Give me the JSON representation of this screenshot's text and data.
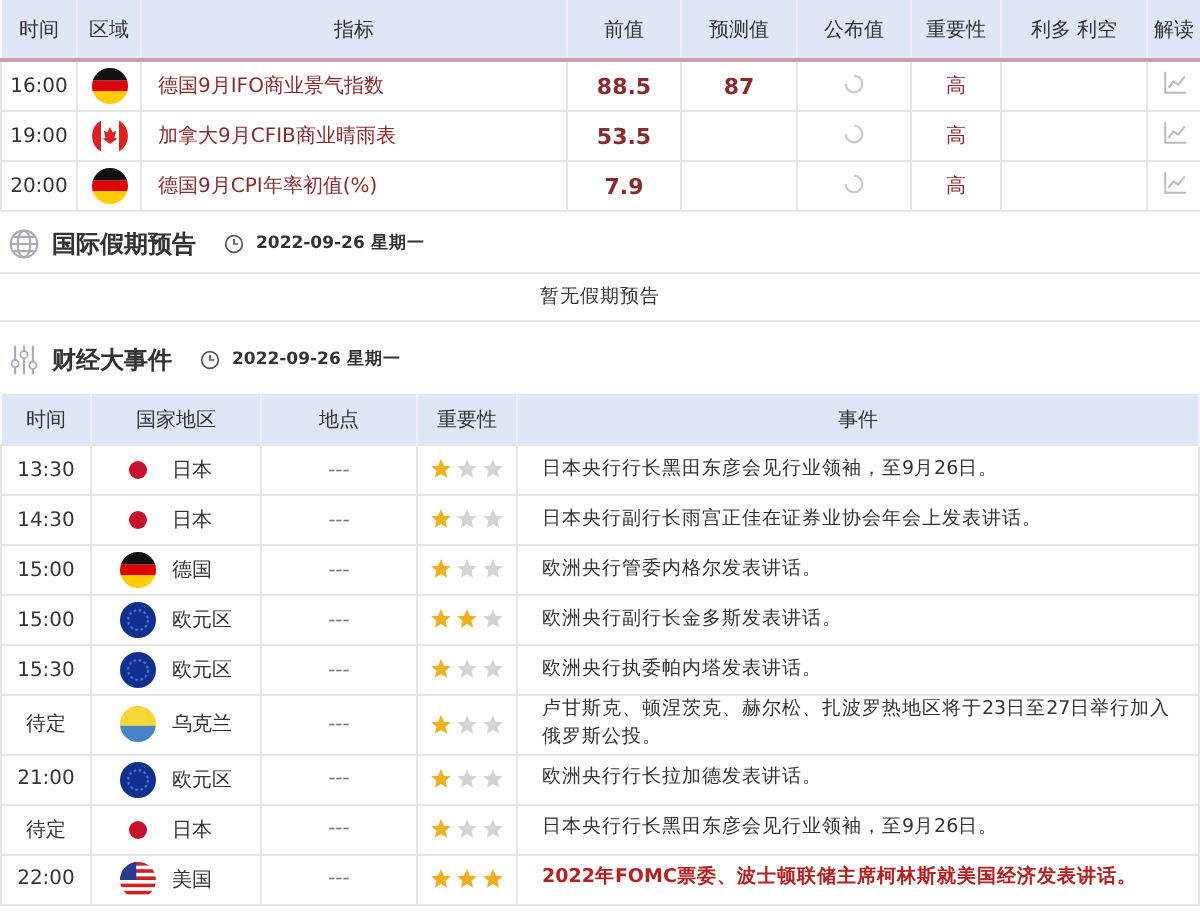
{
  "indicators": {
    "columns": [
      "时间",
      "区域",
      "指标",
      "前值",
      "预测值",
      "公布值",
      "重要性",
      "利多 利空",
      "解读"
    ],
    "rows": [
      {
        "time": "16:00",
        "kind": "de",
        "name": "德国9月IFO商业景气指数",
        "previous": "88.5",
        "forecast": "87",
        "importance": "高"
      },
      {
        "time": "19:00",
        "kind": "ca",
        "name": "加拿大9月CFIB商业晴雨表",
        "previous": "53.5",
        "importance": "高"
      },
      {
        "time": "20:00",
        "kind": "de",
        "name": "德国9月CPI年率初值(%)",
        "previous": "7.9",
        "importance": "高"
      }
    ]
  },
  "holidays": {
    "title": "国际假期预告",
    "date": "2022-09-26 星期一",
    "empty_text": "暂无假期预告"
  },
  "events": {
    "title": "财经大事件",
    "date": "2022-09-26 星期一",
    "columns": [
      "时间",
      "国家地区",
      "地点",
      "重要性",
      "事件"
    ],
    "rows": [
      {
        "time": "13:30",
        "kind": "jp",
        "country": "日本",
        "location": "---",
        "stars": 1,
        "event": "日本央行行长黑田东彦会见行业领袖，至9月26日。"
      },
      {
        "time": "14:30",
        "kind": "jp",
        "country": "日本",
        "location": "---",
        "stars": 1,
        "event": "日本央行副行长雨宫正佳在证券业协会年会上发表讲话。"
      },
      {
        "time": "15:00",
        "kind": "de",
        "country": "德国",
        "location": "---",
        "stars": 1,
        "event": "欧洲央行管委内格尔发表讲话。"
      },
      {
        "time": "15:00",
        "kind": "eu",
        "country": "欧元区",
        "location": "---",
        "stars": 2,
        "event": "欧洲央行副行长金多斯发表讲话。"
      },
      {
        "time": "15:30",
        "kind": "eu",
        "country": "欧元区",
        "location": "---",
        "stars": 1,
        "event": "欧洲央行执委帕内塔发表讲话。"
      },
      {
        "time": "待定",
        "kind": "ua",
        "country": "乌克兰",
        "location": "---",
        "stars": 1,
        "event": "卢甘斯克、顿涅茨克、赫尔松、扎波罗热地区将于23日至27日举行加入俄罗斯公投。"
      },
      {
        "time": "21:00",
        "kind": "eu",
        "country": "欧元区",
        "location": "---",
        "stars": 1,
        "event": "欧洲央行行长拉加德发表讲话。"
      },
      {
        "time": "待定",
        "kind": "jp",
        "country": "日本",
        "location": "---",
        "stars": 1,
        "event": "日本央行行长黑田东彦会见行业领袖，至9月26日。"
      },
      {
        "time": "22:00",
        "kind": "us",
        "country": "美国",
        "location": "---",
        "stars": 3,
        "event": "2022年FOMC票委、波士顿联储主席柯林斯就美国经济发表讲话。"
      }
    ]
  }
}
